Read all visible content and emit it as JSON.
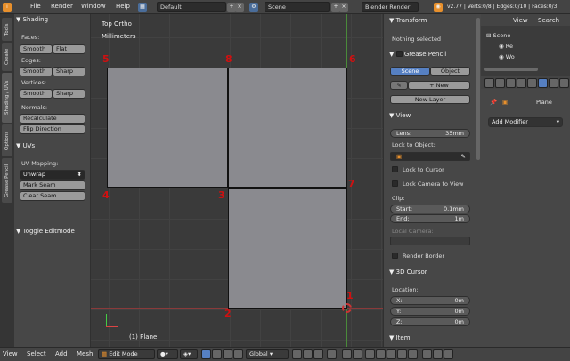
{
  "topbar": {
    "file": "File",
    "render": "Render",
    "window": "Window",
    "help": "Help",
    "layout": "Default",
    "scene": "Scene",
    "engine": "Blender Render",
    "stats": "v2.77 | Verts:0/8 | Edges:0/10 | Faces:0/3"
  },
  "lefttabs": [
    "Tools",
    "Create",
    "Shading / UVs",
    "Options",
    "Grease Pencil"
  ],
  "toolshelf": {
    "shading_header": "Shading",
    "faces_label": "Faces:",
    "smooth": "Smooth",
    "flat": "Flat",
    "edges_label": "Edges:",
    "sharp": "Sharp",
    "vertices_label": "Vertices:",
    "normals_label": "Normals:",
    "recalculate": "Recalculate",
    "flip_direction": "Flip Direction",
    "uvs_header": "UVs",
    "uv_mapping_label": "UV Mapping:",
    "unwrap": "Unwrap",
    "mark_seam": "Mark Seam",
    "clear_seam": "Clear Seam",
    "toggle_editmode": "Toggle Editmode"
  },
  "viewport": {
    "view_name": "Top Ortho",
    "units": "Millimeters",
    "object_label": "(1) Plane",
    "vertex_labels": {
      "v1": "1",
      "v2": "2",
      "v3": "3",
      "v4": "4",
      "v5": "5",
      "v6": "6",
      "v7": "7",
      "v8": "8"
    }
  },
  "props": {
    "transform_header": "Transform",
    "nothing_selected": "Nothing selected",
    "grease_header": "Grease Pencil",
    "scene_btn": "Scene",
    "object_btn": "Object",
    "new_btn": "New",
    "new_layer": "New Layer",
    "view_header": "View",
    "lens_label": "Lens:",
    "lens_value": "35mm",
    "lock_object": "Lock to Object:",
    "lock_cursor": "Lock to Cursor",
    "lock_camera": "Lock Camera to View",
    "clip_label": "Clip:",
    "start_label": "Start:",
    "start_value": "0.1mm",
    "end_label": "End:",
    "end_value": "1m",
    "local_camera": "Local Camera:",
    "render_border": "Render Border",
    "cursor_header": "3D Cursor",
    "location_label": "Location:",
    "x_label": "X:",
    "x_value": "0m",
    "y_label": "Y:",
    "y_value": "0m",
    "z_label": "Z:",
    "z_value": "0m",
    "item_header": "Item"
  },
  "outliner": {
    "view": "View",
    "search": "Search",
    "scene": "Scene",
    "re": "Re",
    "wo": "Wo"
  },
  "propeditor": {
    "object": "Plane",
    "add_modifier": "Add Modifier"
  },
  "bottombar": {
    "view": "View",
    "select": "Select",
    "add": "Add",
    "mesh": "Mesh",
    "mode": "Edit Mode",
    "orientation": "Global"
  }
}
